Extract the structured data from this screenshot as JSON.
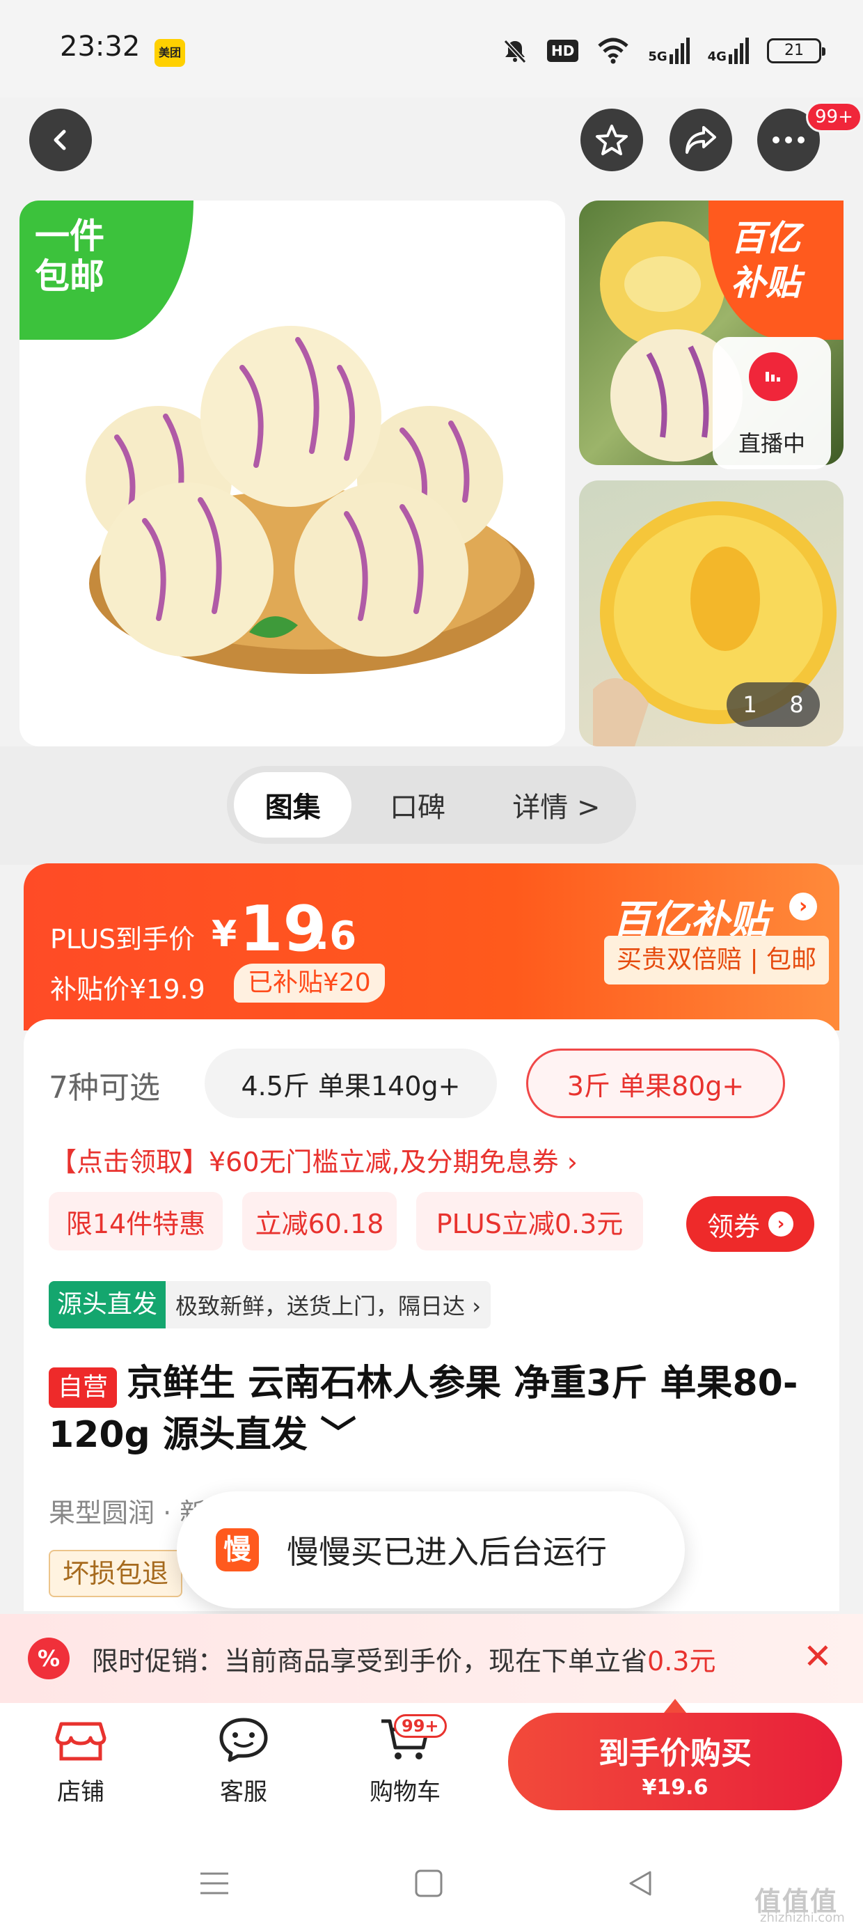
{
  "status_bar": {
    "time": "23:32",
    "app_badge": "美团",
    "hd_label": "HD",
    "net1": "5G",
    "net2": "4G",
    "battery": "21"
  },
  "nav": {
    "more_badge": "99+"
  },
  "gallery": {
    "free_shipping_tag": "一件包邮",
    "subsidy_tag": "百亿补贴",
    "live_label": "直播中",
    "current_index": "1",
    "total_images": "8"
  },
  "tabs": [
    {
      "label": "图集"
    },
    {
      "label": "口碑"
    },
    {
      "label": "详情 >"
    }
  ],
  "price": {
    "plus_label": "PLUS到手价",
    "currency": "¥",
    "integer": "19",
    "decimal": ".6",
    "subsidy_price": "补贴价¥19.9",
    "subsidy_badge": "已补贴¥20",
    "brand": "百亿补贴",
    "guarantee": "买贵双倍赔 | 包邮"
  },
  "variants": {
    "count_label": "7种可选",
    "options": [
      "4.5斤 单果140g+",
      "3斤 单果80g+"
    ],
    "selected_index": 1
  },
  "coupon": {
    "line": "【点击领取】¥60无门槛立减,及分期免息券 ›",
    "chips": [
      "限14件特惠",
      "立减60.18",
      "PLUS立减0.3元"
    ],
    "get_button": "领券"
  },
  "origin": {
    "tag": "源头直发",
    "desc": "极致新鲜，送货上门，隔日达 ›"
  },
  "product": {
    "self_tag": "自营",
    "title": "京鲜生 云南石林人参果 净重3斤 单果80-120g 源头直发 ﹀",
    "feature": "果型圆润 · 新",
    "damage_tag": "坏损包退"
  },
  "toast": {
    "icon_char": "慢",
    "text": "慢慢买已进入后台运行"
  },
  "promo": {
    "icon": "%",
    "text": "限时促销：当前商品享受到手价，现在下单立省",
    "save": "0.3元",
    "close": "✕"
  },
  "bottom_bar": {
    "store": "店铺",
    "service": "客服",
    "cart": "购物车",
    "cart_badge": "99+",
    "buy_main": "到手价购买",
    "buy_sub": "¥19.6"
  },
  "watermark": {
    "main": "值值值",
    "sub": "zhizhizhi.com"
  },
  "colors": {
    "accent_red": "#e8322e",
    "price_orange": "#ff4b26",
    "origin_green": "#14a66e"
  }
}
